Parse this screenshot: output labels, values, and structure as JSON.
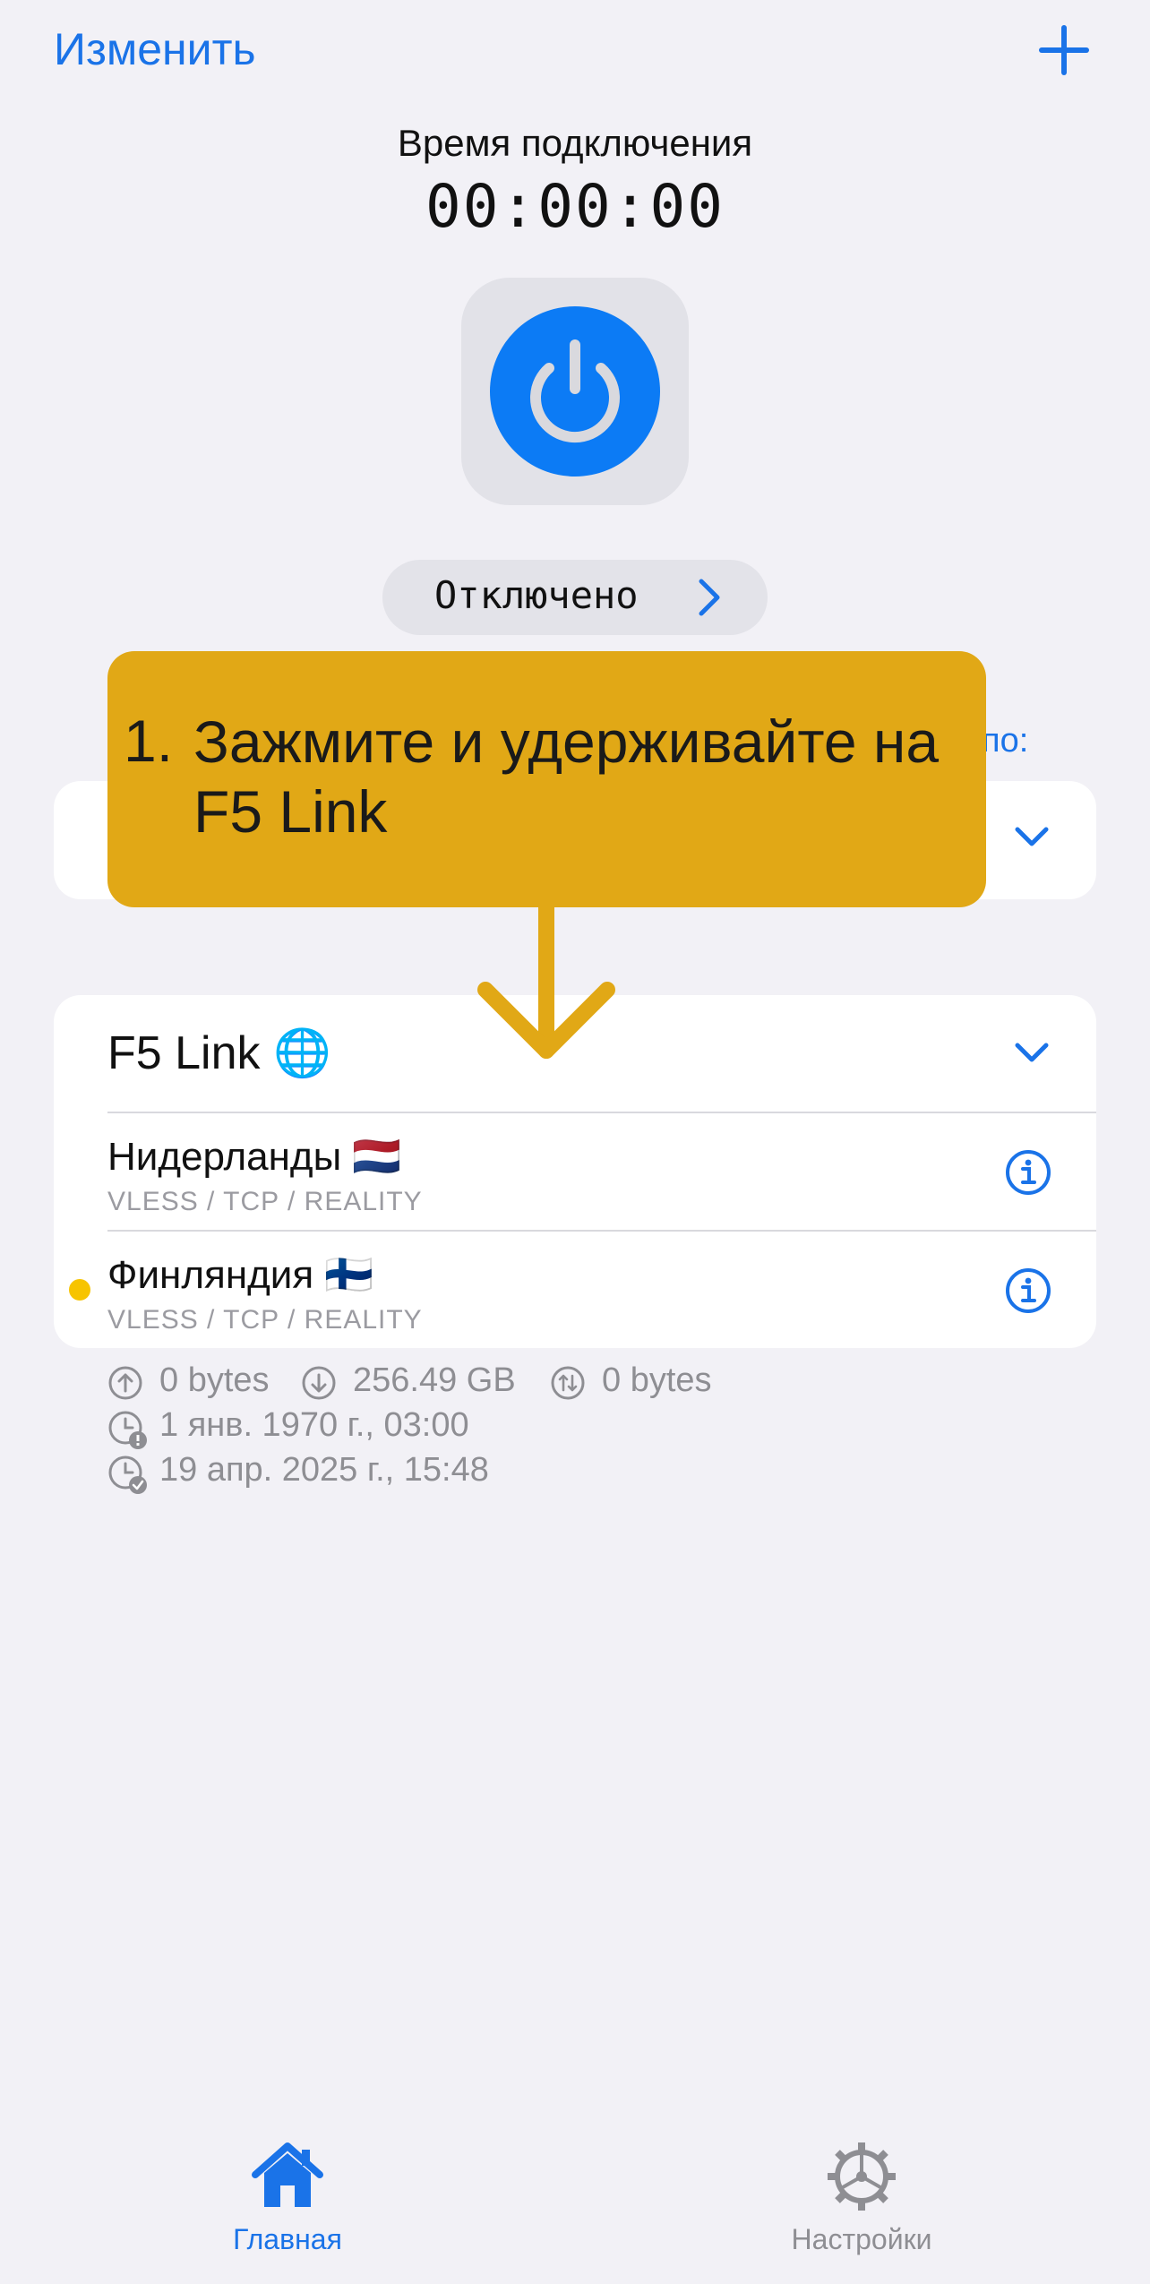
{
  "header": {
    "edit_label": "Изменить",
    "add_icon": "plus-icon"
  },
  "connection": {
    "title": "Время подключения",
    "timer": "00:00:00",
    "power_icon": "power-icon",
    "status": "Отключено"
  },
  "sort_link": "по:",
  "tooltip": {
    "number": "1.",
    "text": "Зажмите и удерживайте на F5 Link"
  },
  "group": {
    "name": "F5 Link 🌐",
    "servers": [
      {
        "name": "Нидерланды 🇳🇱",
        "protocol": "VLESS / TCP / REALITY",
        "active": false
      },
      {
        "name": "Финляндия 🇫🇮",
        "protocol": "VLESS / TCP / REALITY",
        "active": true
      }
    ]
  },
  "stats": {
    "upload": "0 bytes",
    "download": "256.49 GB",
    "total": "0 bytes",
    "expire_date": "1 янв. 1970 г., 03:00",
    "updated_date": "19 апр. 2025 г., 15:48"
  },
  "tabbar": {
    "home_label": "Главная",
    "settings_label": "Настройки"
  },
  "colors": {
    "accent": "#1a73e8",
    "power": "#0c7bf5",
    "tooltip": "#e1a816",
    "active_dot": "#f7c400",
    "background": "#f2f1f6"
  }
}
